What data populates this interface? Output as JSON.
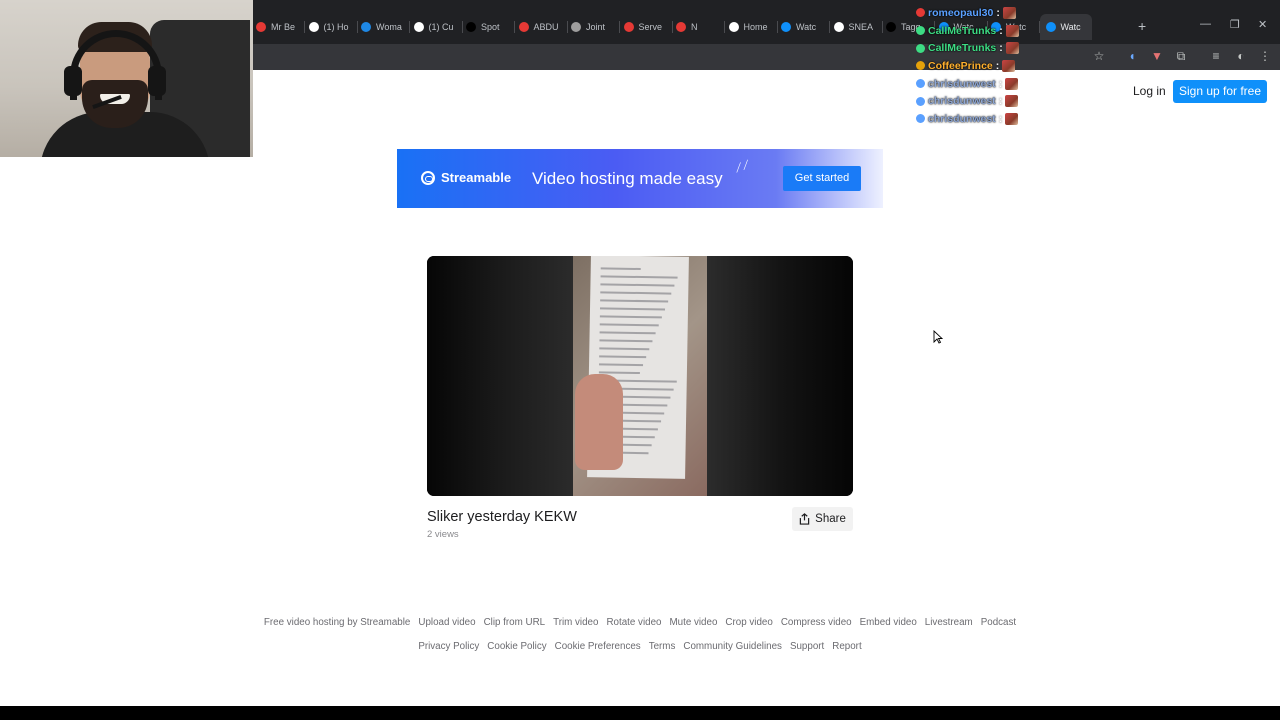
{
  "browser": {
    "tabs": [
      {
        "label": "Mr Be",
        "favicon_color": "#e53935"
      },
      {
        "label": "(1) Ho",
        "favicon_color": "#ffffff"
      },
      {
        "label": "Woma",
        "favicon_color": "#1e88e5"
      },
      {
        "label": "(1) Cu",
        "favicon_color": "#ffffff"
      },
      {
        "label": "Spot",
        "favicon_color": "#000000"
      },
      {
        "label": "ABDU",
        "favicon_color": "#e53935"
      },
      {
        "label": "Joint",
        "favicon_color": "#9e9e9e"
      },
      {
        "label": "Serve",
        "favicon_color": "#e53935"
      },
      {
        "label": "N",
        "favicon_color": "#e53935"
      },
      {
        "label": "Home",
        "favicon_color": "#ffffff"
      },
      {
        "label": "Watc",
        "favicon_color": "#0f90fa"
      },
      {
        "label": "SNEA",
        "favicon_color": "#ffffff"
      },
      {
        "label": "Tagg",
        "favicon_color": "#000000"
      },
      {
        "label": "Watc",
        "favicon_color": "#0f90fa"
      },
      {
        "label": "Watc",
        "favicon_color": "#0f90fa"
      },
      {
        "label": "Watc",
        "favicon_color": "#0f90fa"
      }
    ],
    "new_tab_icon": "plus-icon",
    "window_controls": [
      "minimize-icon",
      "restore-icon",
      "close-icon"
    ],
    "toolbar_icons": [
      "star-icon",
      "extension-icon",
      "puzzle-icon",
      "media-icon",
      "profile-icon",
      "menu-icon"
    ]
  },
  "chat": {
    "messages": [
      {
        "user": "romeopaul30",
        "color": "#5aa0ff",
        "badge_color": "#e53935"
      },
      {
        "user": "CallMeTrunks",
        "color": "#3ddc84",
        "badge_color": "#3ddc84"
      },
      {
        "user": "CallMeTrunks",
        "color": "#3ddc84",
        "badge_color": "#3ddc84"
      },
      {
        "user": "CoffeePrince",
        "color": "#ffb02e",
        "badge_color": "#e5a10a"
      },
      {
        "user": "chrisdunwest",
        "color": "#8fa8d6",
        "badge_color": "#5aa0ff"
      },
      {
        "user": "chrisdunwest",
        "color": "#8fa8d6",
        "badge_color": "#5aa0ff"
      },
      {
        "user": "chrisdunwest",
        "color": "#8fa8d6",
        "badge_color": "#5aa0ff"
      }
    ]
  },
  "header": {
    "login": "Log in",
    "signup": "Sign up for free"
  },
  "banner": {
    "brand": "Streamable",
    "tagline": "Video hosting made easy",
    "cta": "Get started"
  },
  "video": {
    "title": "Sliker yesterday KEKW",
    "views": "2 views",
    "share": "Share"
  },
  "footer": {
    "row1": [
      "Free video hosting by Streamable",
      "Upload video",
      "Clip from URL",
      "Trim video",
      "Rotate video",
      "Mute video",
      "Crop video",
      "Compress video",
      "Embed video",
      "Livestream",
      "Podcast"
    ],
    "row2": [
      "Privacy Policy",
      "Cookie Policy",
      "Cookie Preferences",
      "Terms",
      "Community Guidelines",
      "Support",
      "Report"
    ]
  },
  "colors": {
    "accent": "#0f90fa",
    "banner_gradient_start": "#1971f5",
    "banner_gradient_end": "#6a7bf3"
  }
}
